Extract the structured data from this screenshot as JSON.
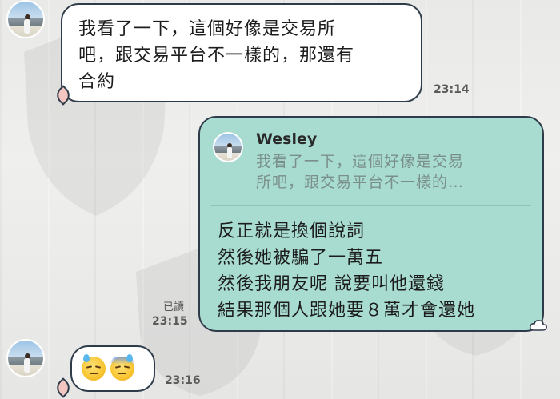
{
  "messages": [
    {
      "id": "msg1",
      "direction": "incoming",
      "lines": [
        "我看了一下，這個好像是交易所",
        "吧，跟交易平台不一樣的，那還有",
        "合約"
      ],
      "time": "23:14"
    },
    {
      "id": "msg2",
      "direction": "outgoing",
      "reply_to": {
        "sender": "Wesley",
        "preview_lines": [
          "我看了一下，這個好像是交易",
          "所吧，跟交易平台不一樣的…"
        ]
      },
      "lines": [
        "反正就是換個說詞",
        "然後她被騙了一萬五",
        "然後我朋友呢 說要叫他還錢",
        "結果那個人跟她要８萬才會還她"
      ],
      "read_label": "已讀",
      "time": "23:15"
    },
    {
      "id": "msg3",
      "direction": "incoming",
      "emojis": [
        "downcast-face-with-sweat",
        "cold-sweat-face"
      ],
      "time": "23:16"
    }
  ],
  "colors": {
    "incoming_bubble": "#ffffff",
    "outgoing_bubble": "#a8dcd1",
    "bubble_border": "#2e3c4a",
    "quote_text": "#7a8f8a"
  },
  "icons": {
    "watermark": "shield-cross-icon",
    "leaf": "leaf-icon",
    "reaction": "cloud-reaction-icon"
  }
}
